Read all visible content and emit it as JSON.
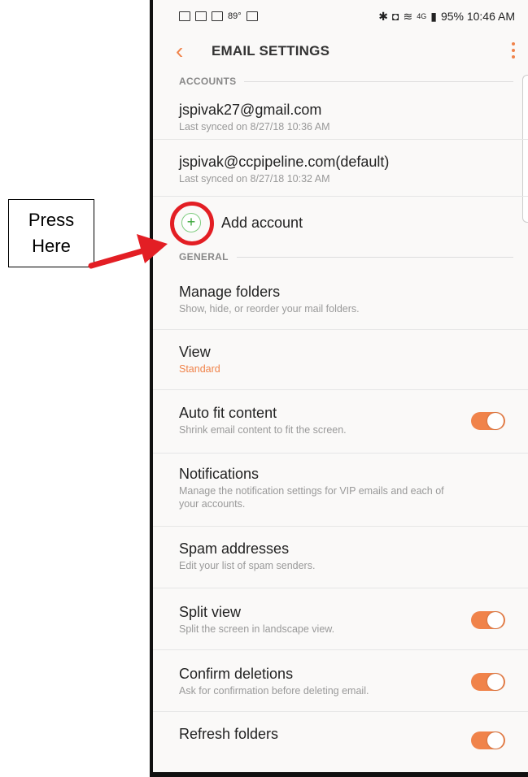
{
  "callout": {
    "line1": "Press",
    "line2": "Here"
  },
  "statusbar": {
    "temp": "89°",
    "time": "95% 10:46 AM",
    "network": "4G"
  },
  "appbar": {
    "title": "EMAIL SETTINGS"
  },
  "accounts": {
    "header": "ACCOUNTS",
    "items": [
      {
        "email": "jspivak27@gmail.com",
        "sync": "Last synced on 8/27/18  10:36 AM"
      },
      {
        "email": "jspivak@ccpipeline.com(default)",
        "sync": "Last synced on 8/27/18  10:32 AM"
      }
    ],
    "add_label": "Add account"
  },
  "general": {
    "header": "GENERAL",
    "items": [
      {
        "title": "Manage folders",
        "sub": "Show, hide, or reorder your mail folders."
      },
      {
        "title": "View",
        "sub": "Standard"
      },
      {
        "title": "Auto fit content",
        "sub": "Shrink email content to fit the screen.",
        "toggle": true
      },
      {
        "title": "Notifications",
        "sub": "Manage the notification settings for VIP emails and each of your accounts."
      },
      {
        "title": "Spam addresses",
        "sub": "Edit your list of spam senders."
      },
      {
        "title": "Split view",
        "sub": "Split the screen in landscape view.",
        "toggle": true
      },
      {
        "title": "Confirm deletions",
        "sub": "Ask for confirmation before deleting email.",
        "toggle": true
      },
      {
        "title": "Refresh folders",
        "sub": "",
        "toggle": true
      }
    ]
  },
  "colors": {
    "accent": "#f0834a",
    "annotation_red": "#e31e24",
    "add_green": "#3aa63a"
  }
}
